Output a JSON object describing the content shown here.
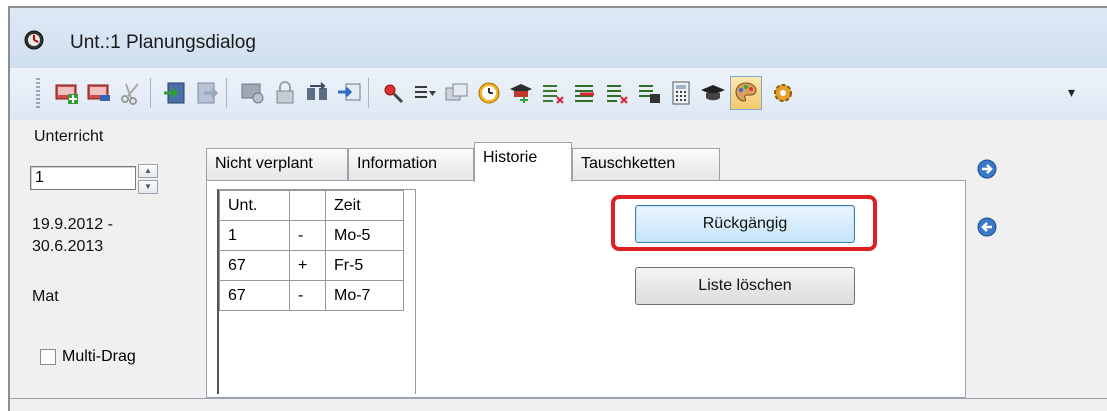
{
  "window": {
    "title": "Unt.:1  Planungsdialog"
  },
  "toolbar": {
    "icons": [
      "add-lesson-icon",
      "lesson-icon",
      "cut-icon",
      "import-icon",
      "export-icon",
      "copy-lesson-icon",
      "lock-icon",
      "swap-icon",
      "transfer-icon",
      "search-icon",
      "list-filter-icon",
      "windows-icon",
      "clock-icon",
      "hat-icon",
      "list-icon",
      "list-remove-icon",
      "list-check-icon",
      "list-edit-icon",
      "calculator-icon",
      "graduation-icon",
      "palette-icon",
      "settings-gear-icon"
    ],
    "more_label": "▾"
  },
  "left": {
    "heading": "Unterricht",
    "spin_value": "1",
    "date_range_line1": "19.9.2012 -",
    "date_range_line2": "30.6.2013",
    "subject": "Mat",
    "multi_drag_label": "Multi-Drag"
  },
  "tabs": [
    {
      "label": "Nicht verplant"
    },
    {
      "label": "Information"
    },
    {
      "label": "Historie"
    },
    {
      "label": "Tauschketten"
    }
  ],
  "history": {
    "headers": [
      "Unt.",
      "",
      "Zeit"
    ],
    "rows": [
      [
        "1",
        "-",
        "Mo-5"
      ],
      [
        "67",
        "+",
        "Fr-5"
      ],
      [
        "67",
        "-",
        "Mo-7"
      ]
    ]
  },
  "buttons": {
    "undo": "Rückgängig",
    "clear_list": "Liste löschen"
  },
  "colors": {
    "highlight": "#e02020",
    "accent": "#3c7fb1"
  }
}
